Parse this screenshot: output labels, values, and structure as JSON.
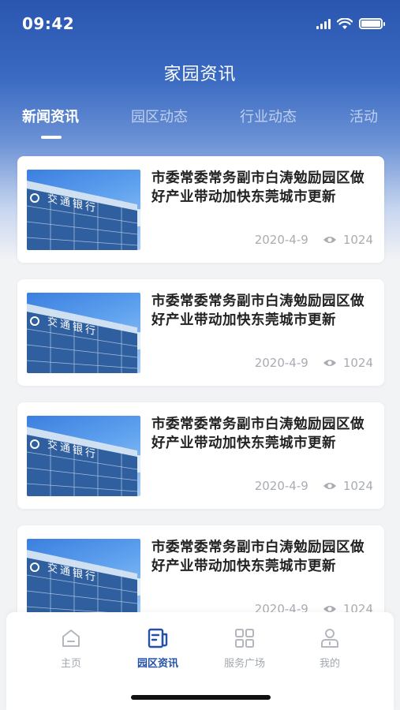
{
  "status_bar": {
    "time": "09:42"
  },
  "page_title": "家园资讯",
  "tabs": [
    {
      "label": "新闻资讯",
      "active": true
    },
    {
      "label": "园区动态",
      "active": false
    },
    {
      "label": "行业动态",
      "active": false
    },
    {
      "label": "活动",
      "active": false
    }
  ],
  "articles": [
    {
      "title": "市委常委常务副市白涛勉励园区做好产业带动加快东莞城市更新",
      "date": "2020-4-9",
      "views": "1024",
      "thumb_sign": "交通银行"
    },
    {
      "title": "市委常委常务副市白涛勉励园区做好产业带动加快东莞城市更新",
      "date": "2020-4-9",
      "views": "1024",
      "thumb_sign": "交通银行"
    },
    {
      "title": "市委常委常务副市白涛勉励园区做好产业带动加快东莞城市更新",
      "date": "2020-4-9",
      "views": "1024",
      "thumb_sign": "交通银行"
    },
    {
      "title": "市委常委常务副市白涛勉励园区做好产业带动加快东莞城市更新",
      "date": "2020-4-9",
      "views": "1024",
      "thumb_sign": "交通银行"
    }
  ],
  "tabbar": [
    {
      "label": "主页",
      "icon": "home-icon",
      "active": false
    },
    {
      "label": "园区资讯",
      "icon": "news-icon",
      "active": true
    },
    {
      "label": "服务广场",
      "icon": "grid-icon",
      "active": false
    },
    {
      "label": "我的",
      "icon": "profile-icon",
      "active": false
    }
  ],
  "colors": {
    "accent": "#2450a8",
    "header_top": "#2a56b0",
    "muted": "#a3a8b0"
  }
}
